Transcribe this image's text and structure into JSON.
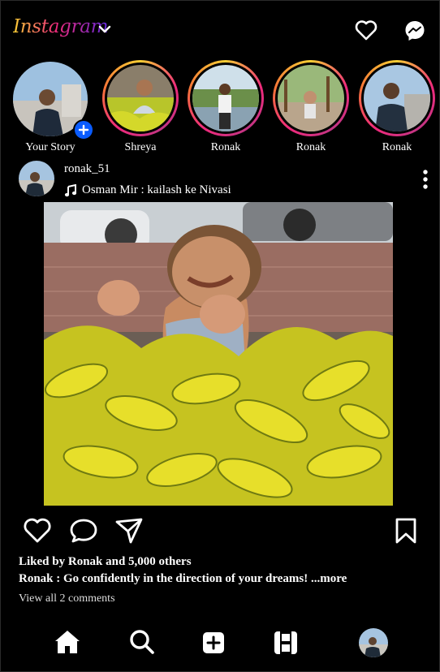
{
  "header": {
    "logo_text": "Instagram",
    "icons": [
      "chevron-down-icon",
      "heart-icon",
      "messenger-icon"
    ]
  },
  "stories": [
    {
      "label": "Your Story",
      "own": true
    },
    {
      "label": "Shreya"
    },
    {
      "label": "Ronak"
    },
    {
      "label": "Ronak"
    },
    {
      "label": "Ronak"
    }
  ],
  "post": {
    "username": "ronak_51",
    "music": "Osman Mir : kailash ke Nivasi",
    "liked_by": "Liked by Ronak and 5,000 others",
    "caption": "Ronak : Go confidently in the direction of your dreams! ...more",
    "view_comments": "View all 2 comments"
  },
  "actions": [
    "heart-icon",
    "comment-icon",
    "share-icon",
    "bookmark-icon"
  ],
  "bottom_nav": [
    "home-icon",
    "search-icon",
    "create-icon",
    "reels-icon",
    "profile-avatar"
  ],
  "colors": {
    "background": "#000000",
    "story_ring_start": "#f9ce34",
    "story_ring_mid": "#ee2a7b",
    "plus_badge": "#0a5cff"
  }
}
